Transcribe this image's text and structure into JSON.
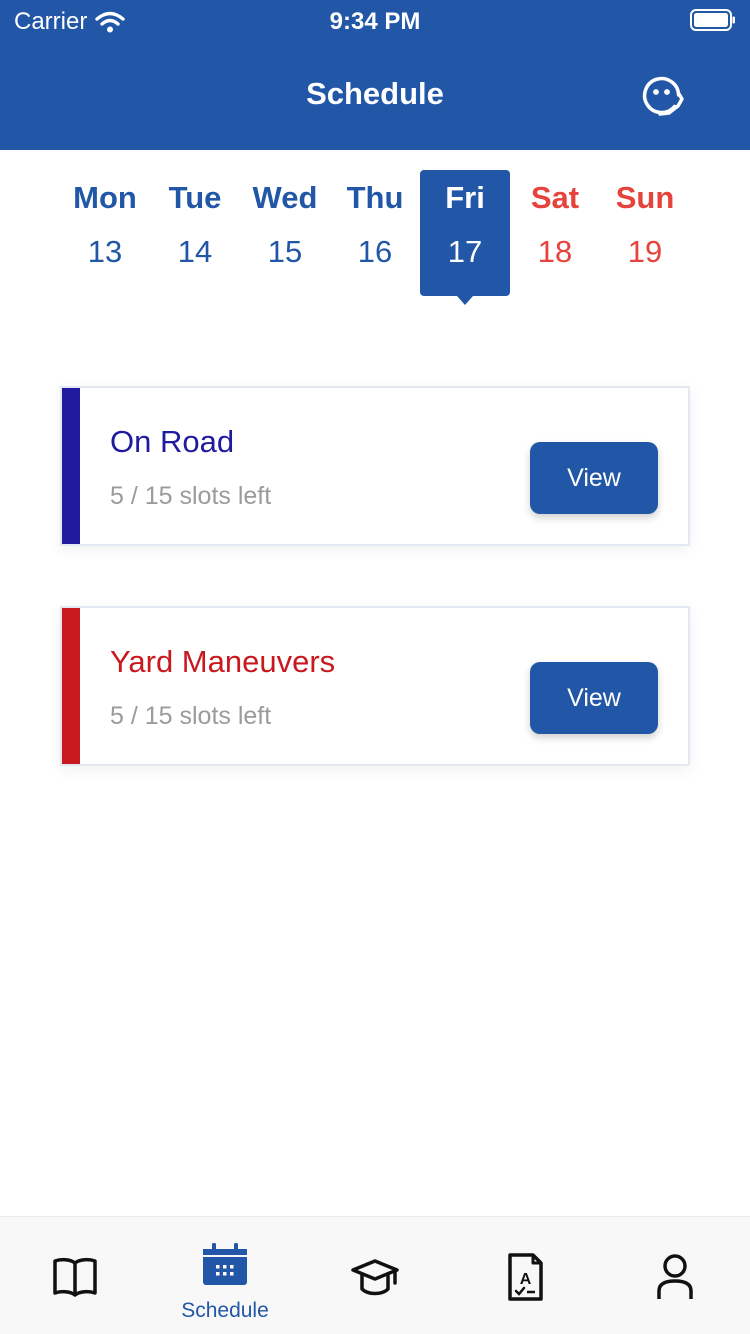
{
  "status_bar": {
    "carrier": "Carrier",
    "time": "9:34 PM"
  },
  "header": {
    "title": "Schedule",
    "support_icon": "support-agent-icon"
  },
  "week": {
    "days": [
      {
        "name": "Mon",
        "date": "13",
        "weekend": false,
        "selected": false
      },
      {
        "name": "Tue",
        "date": "14",
        "weekend": false,
        "selected": false
      },
      {
        "name": "Wed",
        "date": "15",
        "weekend": false,
        "selected": false
      },
      {
        "name": "Thu",
        "date": "16",
        "weekend": false,
        "selected": false
      },
      {
        "name": "Fri",
        "date": "17",
        "weekend": false,
        "selected": true
      },
      {
        "name": "Sat",
        "date": "18",
        "weekend": true,
        "selected": false
      },
      {
        "name": "Sun",
        "date": "19",
        "weekend": true,
        "selected": false
      }
    ]
  },
  "sessions": [
    {
      "title": "On Road",
      "slots": "5 / 15 slots left",
      "button": "View",
      "color": "#1f1a9e"
    },
    {
      "title": "Yard Maneuvers",
      "slots": "5 / 15 slots left",
      "button": "View",
      "color": "#c8191e"
    }
  ],
  "tabbar": {
    "tabs": [
      {
        "icon": "book-icon",
        "label": ""
      },
      {
        "icon": "calendar-icon",
        "label": "Schedule"
      },
      {
        "icon": "graduation-cap-icon",
        "label": ""
      },
      {
        "icon": "document-grade-icon",
        "label": ""
      },
      {
        "icon": "person-icon",
        "label": ""
      }
    ],
    "active_index": 1
  },
  "colors": {
    "primary": "#2157a6",
    "weekend": "#e5433b",
    "muted": "#9b9b9b"
  }
}
